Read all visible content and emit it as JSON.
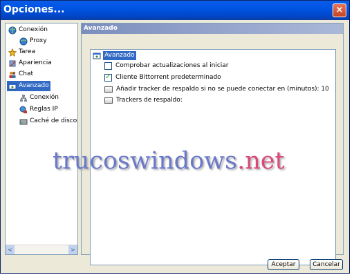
{
  "window": {
    "title": "Opciones...",
    "close_symbol": "×"
  },
  "tree": {
    "items": [
      {
        "label": "Conexión",
        "icon": "globe-icon"
      },
      {
        "label": "Proxy",
        "icon": "globe-icon"
      },
      {
        "label": "Tarea",
        "icon": "star-icon"
      },
      {
        "label": "Apariencia",
        "icon": "brush-icon"
      },
      {
        "label": "Chat",
        "icon": "people-icon"
      },
      {
        "label": "Avanzado",
        "icon": "settings-window-icon",
        "selected": true
      },
      {
        "label": "Conexión",
        "icon": "network-icon"
      },
      {
        "label": "Reglas IP",
        "icon": "network-rules-icon"
      },
      {
        "label": "Caché de disco",
        "icon": "disk-icon"
      }
    ]
  },
  "panel": {
    "header": "Avanzado",
    "section_label": "Avanzado",
    "options": [
      {
        "label": "Comprobar actualizaciones al iniciar",
        "type": "checkbox",
        "checked": false
      },
      {
        "label": "Cliente Bittorrent predeterminado",
        "type": "checkbox",
        "checked": true
      },
      {
        "label": "Añadir tracker de respaldo si no se puede conectar en (minutos): 10",
        "type": "field"
      },
      {
        "label": "Trackers de respaldo:",
        "type": "field"
      }
    ]
  },
  "watermark": {
    "main": "trucoswindows",
    "accent": ".net"
  },
  "buttons": {
    "accept": "Aceptar",
    "cancel": "Cancelar"
  },
  "scroll": {
    "left": "<",
    "right": ">"
  }
}
